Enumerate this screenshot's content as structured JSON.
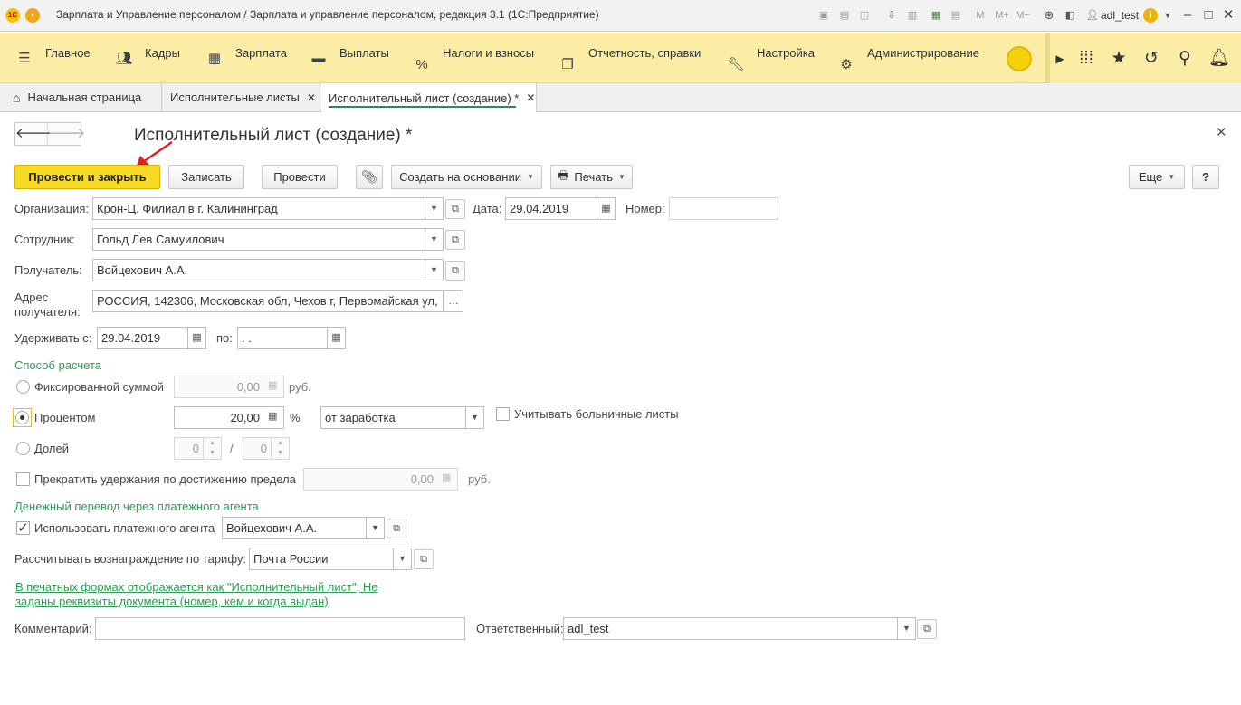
{
  "window": {
    "title": "Зарплата и Управление персоналом / Зарплата и управление персоналом, редакция 3.1  (1С:Предприятие)",
    "user": "adl_test",
    "toolbar_letters": {
      "m": "M",
      "m_plus": "M+",
      "m_minus": "M−"
    }
  },
  "sections": [
    {
      "label": "Главное",
      "icon": "menu-icon"
    },
    {
      "label": "Кадры",
      "icon": "people-icon"
    },
    {
      "label": "Зарплата",
      "icon": "calculator-icon"
    },
    {
      "label": "Выплаты",
      "icon": "wallet-icon"
    },
    {
      "label": "Налоги и взносы",
      "icon": "percent-icon"
    },
    {
      "label": "Отчетность, справки",
      "icon": "documents-icon"
    },
    {
      "label": "Настройка",
      "icon": "wrench-icon"
    },
    {
      "label": "Администрирование",
      "icon": "gear-icon"
    }
  ],
  "tabs": [
    {
      "label": "Начальная страница"
    },
    {
      "label": "Исполнительные листы"
    },
    {
      "label": "Исполнительный лист (создание) *"
    }
  ],
  "form": {
    "title": "Исполнительный лист (создание) *",
    "buttons": {
      "post_close": "Провести и закрыть",
      "save": "Записать",
      "post": "Провести",
      "create_based": "Создать на основании",
      "print": "Печать",
      "more": "Еще",
      "help": "?"
    },
    "organization": {
      "label": "Организация:",
      "value": "Крон-Ц. Филиал в г. Калининград"
    },
    "date": {
      "label": "Дата:",
      "value": "29.04.2019"
    },
    "number": {
      "label": "Номер:",
      "value": ""
    },
    "employee": {
      "label": "Сотрудник:",
      "value": "Гольд Лев Самуилович"
    },
    "recipient": {
      "label": "Получатель:",
      "value": "Войцехович А.А."
    },
    "address": {
      "label_line1": "Адрес",
      "label_line2": "получателя:",
      "value": "РОССИЯ, 142306, Московская обл, Чехов г, Первомайская ул,"
    },
    "withhold_from": {
      "label": "Удерживать с:",
      "value": "29.04.2019"
    },
    "withhold_to": {
      "label": "по:",
      "value": " .  ."
    },
    "calc_method": {
      "heading": "Способ расчета",
      "fixed": {
        "label": "Фиксированной суммой",
        "value": "0,00",
        "unit": "руб."
      },
      "percent": {
        "label": "Процентом",
        "value": "20,00",
        "unit": "%",
        "base": "от заработка",
        "sick_leave_label": "Учитывать больничные листы"
      },
      "share": {
        "label": "Долей",
        "numerator": "0",
        "separator": "/",
        "denominator": "0"
      },
      "selected": "percent"
    },
    "limit": {
      "label": "Прекратить удержания по достижению предела",
      "value": "0,00",
      "unit": "руб."
    },
    "transfer": {
      "heading": "Денежный перевод через платежного агента",
      "use_agent_label": "Использовать платежного агента",
      "use_agent_checked": true,
      "agent": "Войцехович А.А.",
      "tariff_label": "Рассчитывать вознаграждение по тарифу:",
      "tariff": "Почта России"
    },
    "print_note_line1": "В печатных формах отображается как \"Исполнительный лист\"; Не",
    "print_note_line2": "заданы реквизиты документа (номер, кем и когда выдан)",
    "comment": {
      "label": "Комментарий:",
      "value": ""
    },
    "responsible": {
      "label": "Ответственный:",
      "value": "adl_test"
    }
  },
  "colors": {
    "accent_yellow": "#f7db25",
    "sections_bg": "#fbeda6",
    "green_text": "#2d9d54",
    "annotation_arrow": "#e02020"
  }
}
